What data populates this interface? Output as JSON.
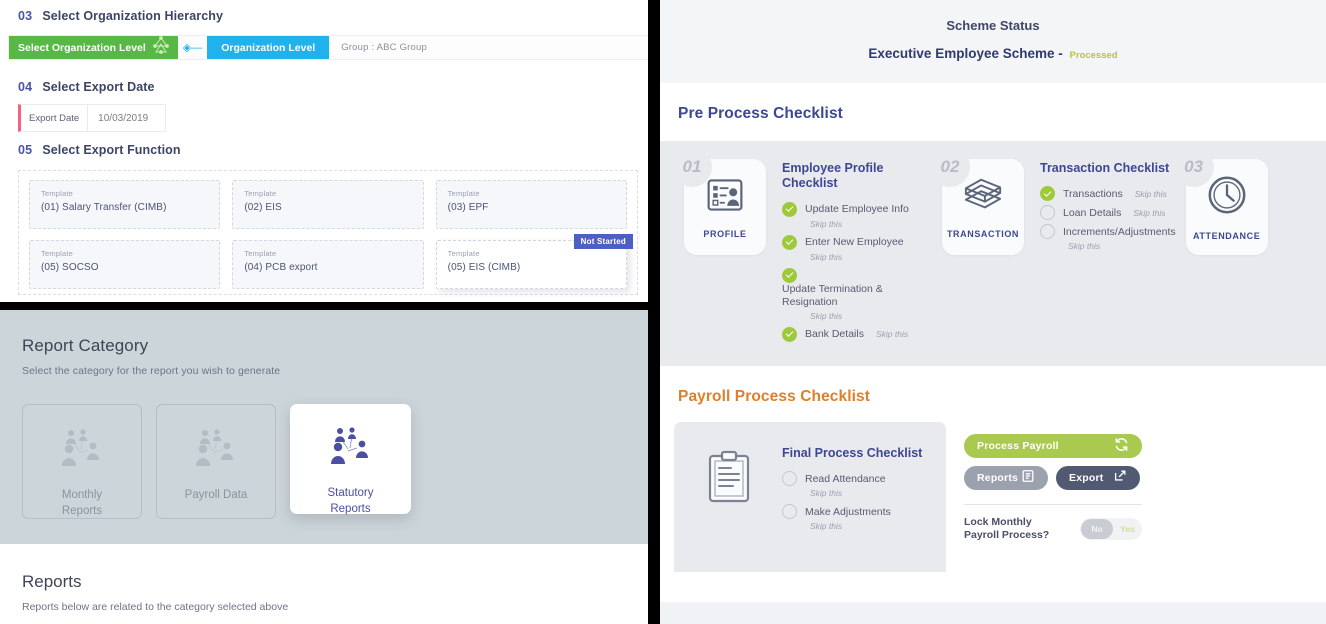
{
  "export_wizard": {
    "steps": [
      {
        "num": "03",
        "title": "Select Organization Hierarchy"
      },
      {
        "num": "04",
        "title": "Select Export Date"
      },
      {
        "num": "05",
        "title": "Select Export Function"
      }
    ],
    "org_bar": {
      "select_button": "Select Organization Level",
      "level_chip": "Organization Level",
      "group_text": "Group : ABC Group"
    },
    "export_date": {
      "label": "Export Date",
      "value": "10/03/2019"
    },
    "templates": [
      {
        "kicker": "Template",
        "name": "(01) Salary Transfer (CIMB)",
        "selected": false,
        "badge": ""
      },
      {
        "kicker": "Template",
        "name": "(02) EIS",
        "selected": false,
        "badge": ""
      },
      {
        "kicker": "Template",
        "name": "(03) EPF",
        "selected": false,
        "badge": ""
      },
      {
        "kicker": "Template",
        "name": "(05) SOCSO",
        "selected": false,
        "badge": ""
      },
      {
        "kicker": "Template",
        "name": "(04) PCB export",
        "selected": false,
        "badge": ""
      },
      {
        "kicker": "Template",
        "name": "(05) EIS (CIMB)",
        "selected": true,
        "badge": "Not Started"
      }
    ]
  },
  "report_category": {
    "title": "Report Category",
    "subtitle": "Select the category for the report you wish to generate",
    "cards": [
      {
        "label_line1": "Monthly",
        "label_line2": "Reports",
        "active": false
      },
      {
        "label_line1": "Payroll Data",
        "label_line2": "",
        "active": false
      },
      {
        "label_line1": "Statutory",
        "label_line2": "Reports",
        "active": true
      }
    ],
    "reports_title": "Reports",
    "reports_subtitle": "Reports below are related to the category selected above"
  },
  "scheme": {
    "header": {
      "title": "Scheme Status",
      "scheme_name": "Executive Employee Scheme -",
      "status": "Processed"
    },
    "pre_process_title": "Pre Process Checklist",
    "pre_cards": [
      {
        "num": "01",
        "icon": "profile-card-icon",
        "card_label": "PROFILE",
        "list_title": "Employee Profile Checklist",
        "items": [
          {
            "state": "done",
            "text": "Update Employee Info",
            "skip": "Skip this",
            "skip_inline": false,
            "stacked": false
          },
          {
            "state": "done",
            "text": "Enter New Employee",
            "skip": "Skip this",
            "skip_inline": false,
            "stacked": false
          },
          {
            "state": "done",
            "text": "Update Termination & Resignation",
            "skip": "Skip this",
            "skip_inline": false,
            "stacked": true
          },
          {
            "state": "done",
            "text": "Bank Details",
            "skip": "Skip this",
            "skip_inline": true,
            "stacked": false
          }
        ]
      },
      {
        "num": "02",
        "icon": "money-stack-icon",
        "card_label": "TRANSACTION",
        "list_title": "Transaction Checklist",
        "items": [
          {
            "state": "done",
            "text": "Transactions",
            "skip": "Skip this",
            "skip_inline": true,
            "stacked": false
          },
          {
            "state": "todo",
            "text": "Loan Details",
            "skip": "Skip this",
            "skip_inline": true,
            "stacked": false
          },
          {
            "state": "todo",
            "text": "Increments/Adjustments",
            "skip": "Skip this",
            "skip_inline": false,
            "stacked": false
          }
        ]
      },
      {
        "num": "03",
        "icon": "clock-icon",
        "card_label": "ATTENDANCE",
        "list_title": "",
        "items": []
      }
    ],
    "payroll_process_title": "Payroll Process Checklist",
    "payroll_card": {
      "icon": "clipboard-icon",
      "list_title": "Final Process Checklist",
      "items": [
        {
          "state": "todo",
          "text": "Read Attendance",
          "skip": "Skip this"
        },
        {
          "state": "todo",
          "text": "Make Adjustments",
          "skip": "Skip this"
        }
      ]
    },
    "actions": {
      "process_payroll": "Process Payroll",
      "process_payroll_icon": "refresh-icon",
      "reports": "Reports",
      "reports_icon": "printer-icon",
      "export": "Export",
      "export_icon": "external-link-icon",
      "lock_label_line1": "Lock Monthly",
      "lock_label_line2": "Payroll Process?",
      "toggle_off": "No",
      "toggle_on": "Yes"
    }
  },
  "colors": {
    "green": "#57b846",
    "blue": "#1fb2ed",
    "indigo": "#3d4793",
    "orange": "#dd7f2c",
    "lime": "#a9ca4e",
    "badge_blue": "#4e5fc4",
    "status_olive": "#b7c24a",
    "dark_slate": "#515a72"
  }
}
